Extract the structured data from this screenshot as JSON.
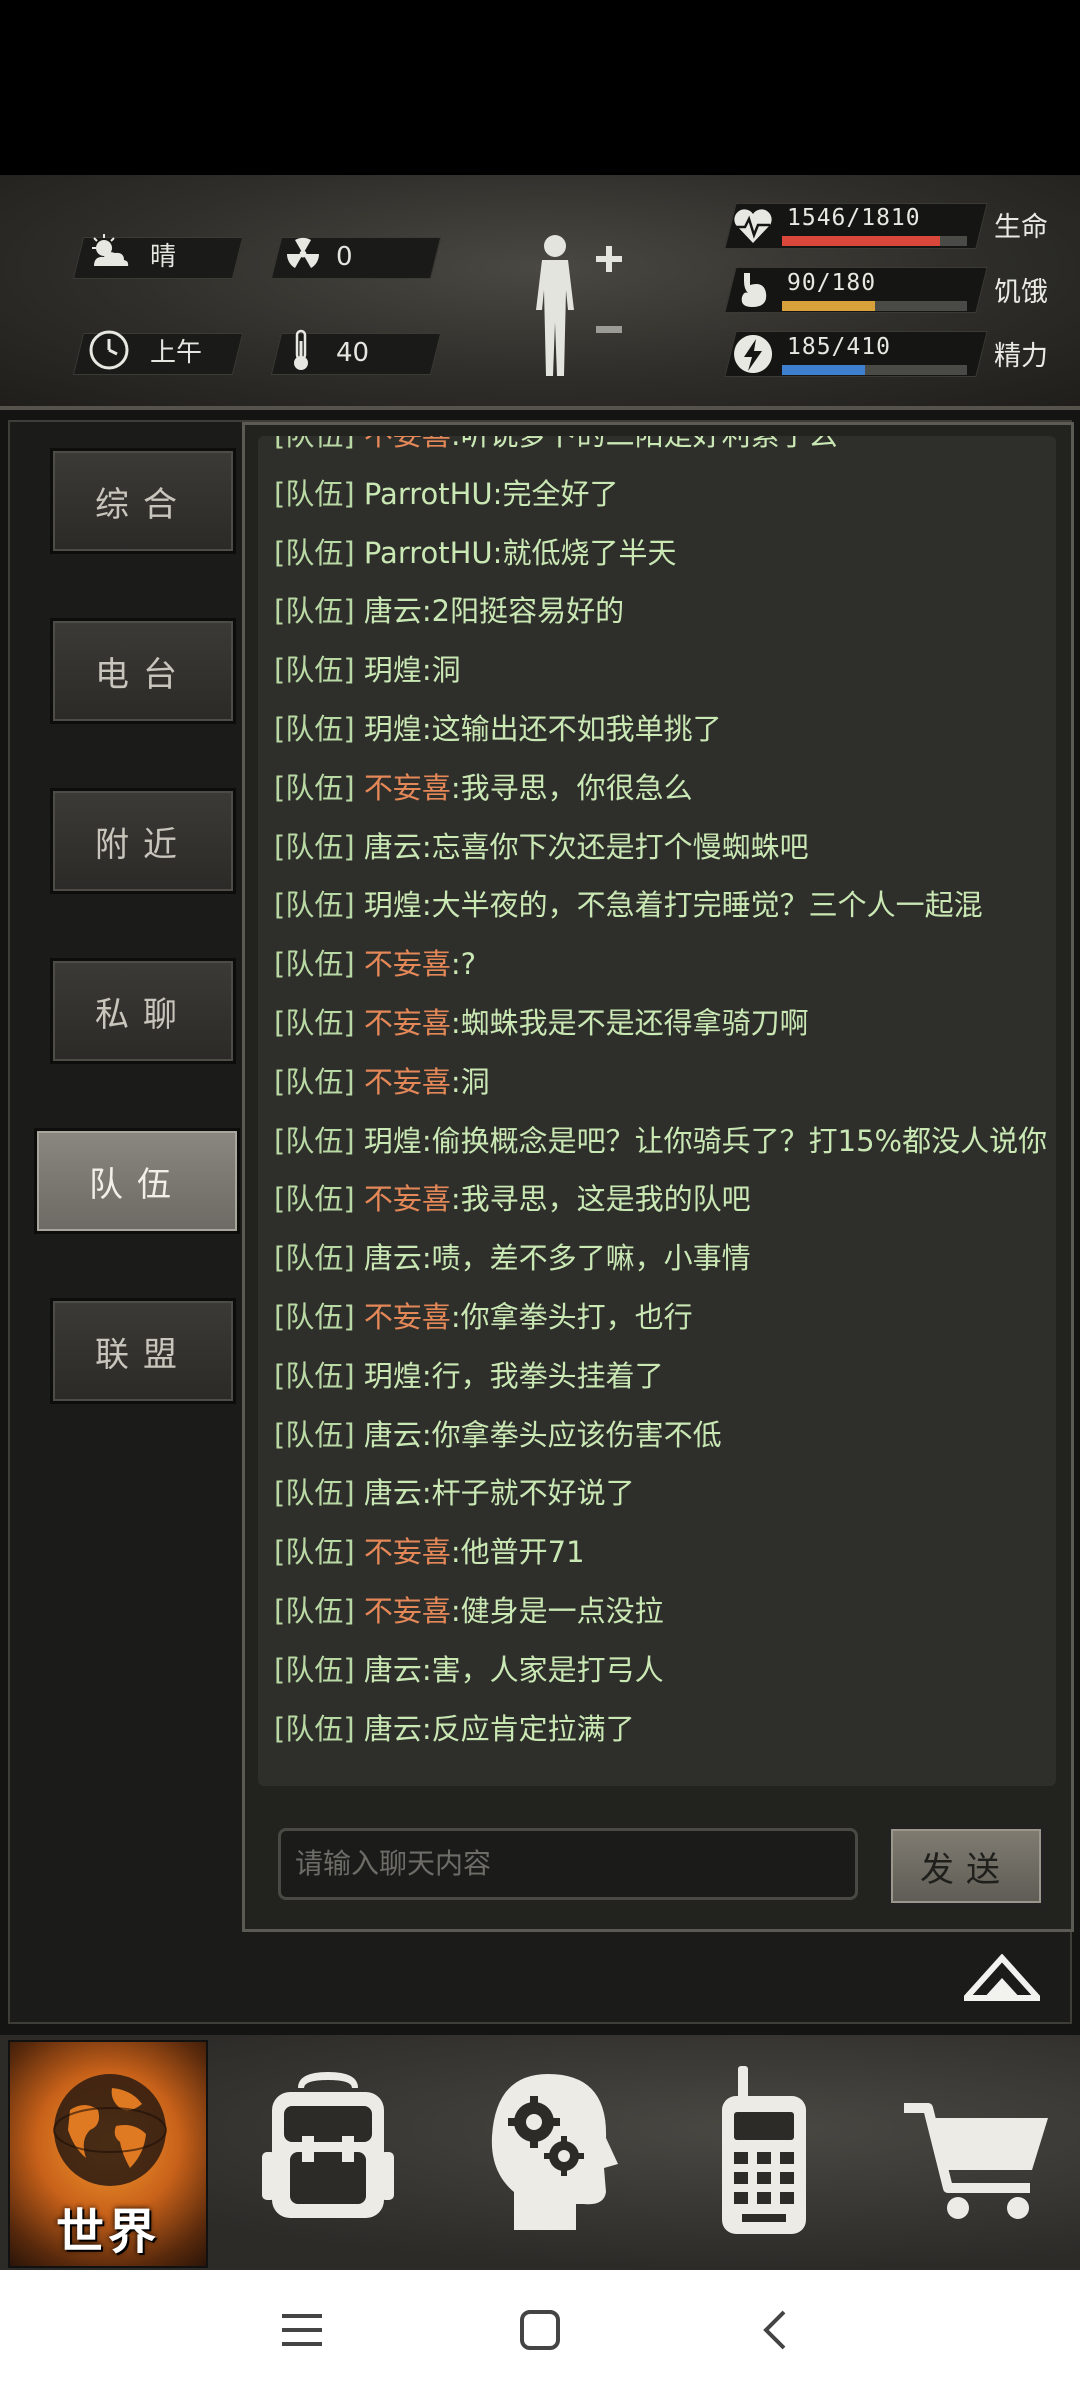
{
  "status": {
    "weather": "晴",
    "radiation": "0",
    "time_of_day": "上午",
    "temperature": "40"
  },
  "vitals": {
    "life": {
      "value": "1546/1810",
      "label": "生命",
      "fraction": 0.854,
      "color": "#d9483b"
    },
    "hunger": {
      "value": "90/180",
      "label": "饥饿",
      "fraction": 0.5,
      "color": "#d9a13a"
    },
    "energy": {
      "value": "185/410",
      "label": "精力",
      "fraction": 0.451,
      "color": "#3f7fd0"
    }
  },
  "side_tabs": [
    {
      "label": "综合",
      "active": false
    },
    {
      "label": "电台",
      "active": false
    },
    {
      "label": "附近",
      "active": false
    },
    {
      "label": "私聊",
      "active": false
    },
    {
      "label": "队伍",
      "active": true
    },
    {
      "label": "联盟",
      "active": false
    }
  ],
  "chat": {
    "messages": [
      {
        "channel": "[队伍]",
        "sender": "不妄喜",
        "highlight": true,
        "text": ":听说萝卜的二阳是好利索了么"
      },
      {
        "channel": "[队伍]",
        "sender": "ParrotHU",
        "highlight": false,
        "text": ":完全好了"
      },
      {
        "channel": "[队伍]",
        "sender": "ParrotHU",
        "highlight": false,
        "text": ":就低烧了半天"
      },
      {
        "channel": "[队伍]",
        "sender": "唐云",
        "highlight": false,
        "text": ":2阳挺容易好的"
      },
      {
        "channel": "[队伍]",
        "sender": "玥煌",
        "highlight": false,
        "text": ":洞"
      },
      {
        "channel": "[队伍]",
        "sender": "玥煌",
        "highlight": false,
        "text": ":这输出还不如我单挑了"
      },
      {
        "channel": "[队伍]",
        "sender": "不妄喜",
        "highlight": true,
        "text": ":我寻思，你很急么"
      },
      {
        "channel": "[队伍]",
        "sender": "唐云",
        "highlight": false,
        "text": ":忘喜你下次还是打个慢蜘蛛吧"
      },
      {
        "channel": "[队伍]",
        "sender": "玥煌",
        "highlight": false,
        "text": ":大半夜的，不急着打完睡觉？三个人一起混"
      },
      {
        "channel": "[队伍]",
        "sender": "不妄喜",
        "highlight": true,
        "text": ":?"
      },
      {
        "channel": "[队伍]",
        "sender": "不妄喜",
        "highlight": true,
        "text": ":蜘蛛我是不是还得拿骑刀啊"
      },
      {
        "channel": "[队伍]",
        "sender": "不妄喜",
        "highlight": true,
        "text": ":洞"
      },
      {
        "channel": "[队伍]",
        "sender": "玥煌",
        "highlight": false,
        "text": ":偷换概念是吧？让你骑兵了？打15%都没人说你"
      },
      {
        "channel": "[队伍]",
        "sender": "不妄喜",
        "highlight": true,
        "text": ":我寻思，这是我的队吧"
      },
      {
        "channel": "[队伍]",
        "sender": "唐云",
        "highlight": false,
        "text": ":啧，差不多了嘛，小事情"
      },
      {
        "channel": "[队伍]",
        "sender": "不妄喜",
        "highlight": true,
        "text": ":你拿拳头打，也行"
      },
      {
        "channel": "[队伍]",
        "sender": "玥煌",
        "highlight": false,
        "text": ":行，我拳头挂着了"
      },
      {
        "channel": "[队伍]",
        "sender": "唐云",
        "highlight": false,
        "text": ":你拿拳头应该伤害不低"
      },
      {
        "channel": "[队伍]",
        "sender": "唐云",
        "highlight": false,
        "text": ":杆子就不好说了"
      },
      {
        "channel": "[队伍]",
        "sender": "不妄喜",
        "highlight": true,
        "text": ":他普开71"
      },
      {
        "channel": "[队伍]",
        "sender": "不妄喜",
        "highlight": true,
        "text": ":健身是一点没拉"
      },
      {
        "channel": "[队伍]",
        "sender": "唐云",
        "highlight": false,
        "text": ":害，人家是打弓人"
      },
      {
        "channel": "[队伍]",
        "sender": "唐云",
        "highlight": false,
        "text": ":反应肯定拉满了"
      }
    ],
    "input_placeholder": "请输入聊天内容",
    "send_label": "发送"
  },
  "bottom_nav": {
    "world_label": "世界",
    "items": [
      "backpack-icon",
      "skills-head-icon",
      "radio-phone-icon",
      "shopping-cart-icon"
    ]
  },
  "colors": {
    "highlight_sender": "#e58858",
    "chat_text": "#c9e8b4",
    "accent_orange": "#f29a2e"
  }
}
